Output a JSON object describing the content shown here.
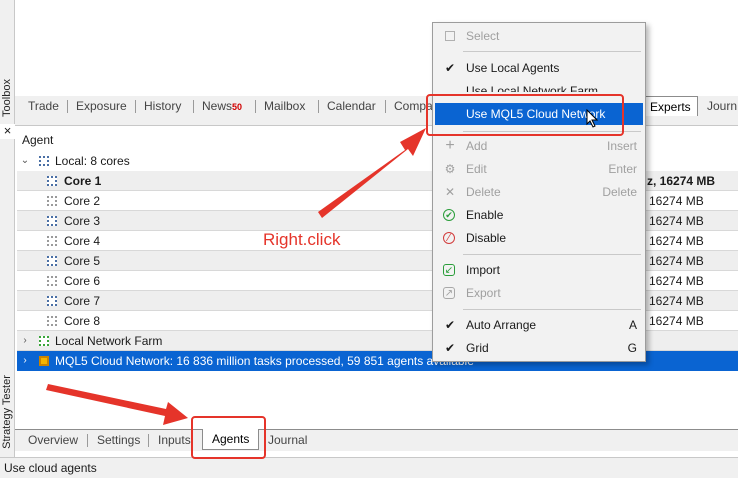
{
  "side_panels": {
    "toolbox_label": "Toolbox",
    "tester_label": "Strategy Tester",
    "close_glyph": "×"
  },
  "toolbox_tabs": {
    "trade": "Trade",
    "exposure": "Exposure",
    "history": "History",
    "news": "News",
    "news_count": "50",
    "mailbox": "Mailbox",
    "calendar": "Calendar",
    "company_partial": "Compa",
    "experts": "Experts",
    "journal_partial": "Journ"
  },
  "agents_panel": {
    "column_header": "Agent",
    "local_group": "Local: 8 cores",
    "cores": [
      {
        "name": "Core 1",
        "mem": "z, 16274 MB",
        "bold": true,
        "icon": "chip-blue-icon"
      },
      {
        "name": "Core 2",
        "mem": "16274 MB",
        "icon": "chip-gray-icon"
      },
      {
        "name": "Core 3",
        "mem": "16274 MB",
        "icon": "chip-blue-icon"
      },
      {
        "name": "Core 4",
        "mem": "16274 MB",
        "icon": "chip-gray-icon"
      },
      {
        "name": "Core 5",
        "mem": "16274 MB",
        "icon": "chip-blue-icon"
      },
      {
        "name": "Core 6",
        "mem": "16274 MB",
        "icon": "chip-gray-icon"
      },
      {
        "name": "Core 7",
        "mem": "16274 MB",
        "icon": "chip-blue-icon"
      },
      {
        "name": "Core 8",
        "mem": "16274 MB",
        "icon": "chip-gray-icon"
      }
    ],
    "network_farm": "Local Network Farm",
    "cloud_network": "MQL5 Cloud Network: 16 836 million tasks processed, 59 851 agents available"
  },
  "annotation": {
    "text": "Right.click",
    "color": "#e5342a"
  },
  "bottom_tabs": {
    "overview": "Overview",
    "settings": "Settings",
    "inputs": "Inputs",
    "agents": "Agents",
    "journal": "Journal"
  },
  "status_bar": {
    "text": "Use cloud agents"
  },
  "context_menu": {
    "select": "Select",
    "use_local_agents": "Use Local Agents",
    "use_local_network_farm": "Use Local Network Farm",
    "use_mql5_cloud": "Use MQL5 Cloud Network",
    "add": "Add",
    "add_shortcut": "Insert",
    "edit": "Edit",
    "edit_shortcut": "Enter",
    "delete": "Delete",
    "delete_shortcut": "Delete",
    "enable": "Enable",
    "disable": "Disable",
    "import": "Import",
    "export": "Export",
    "auto_arrange": "Auto Arrange",
    "auto_arrange_shortcut": "A",
    "grid": "Grid",
    "grid_shortcut": "G",
    "checkmark": "✔"
  },
  "colors": {
    "selection": "#0a64d2",
    "annotation_red": "#e5342a",
    "panel_bg": "#f0f0f0"
  }
}
